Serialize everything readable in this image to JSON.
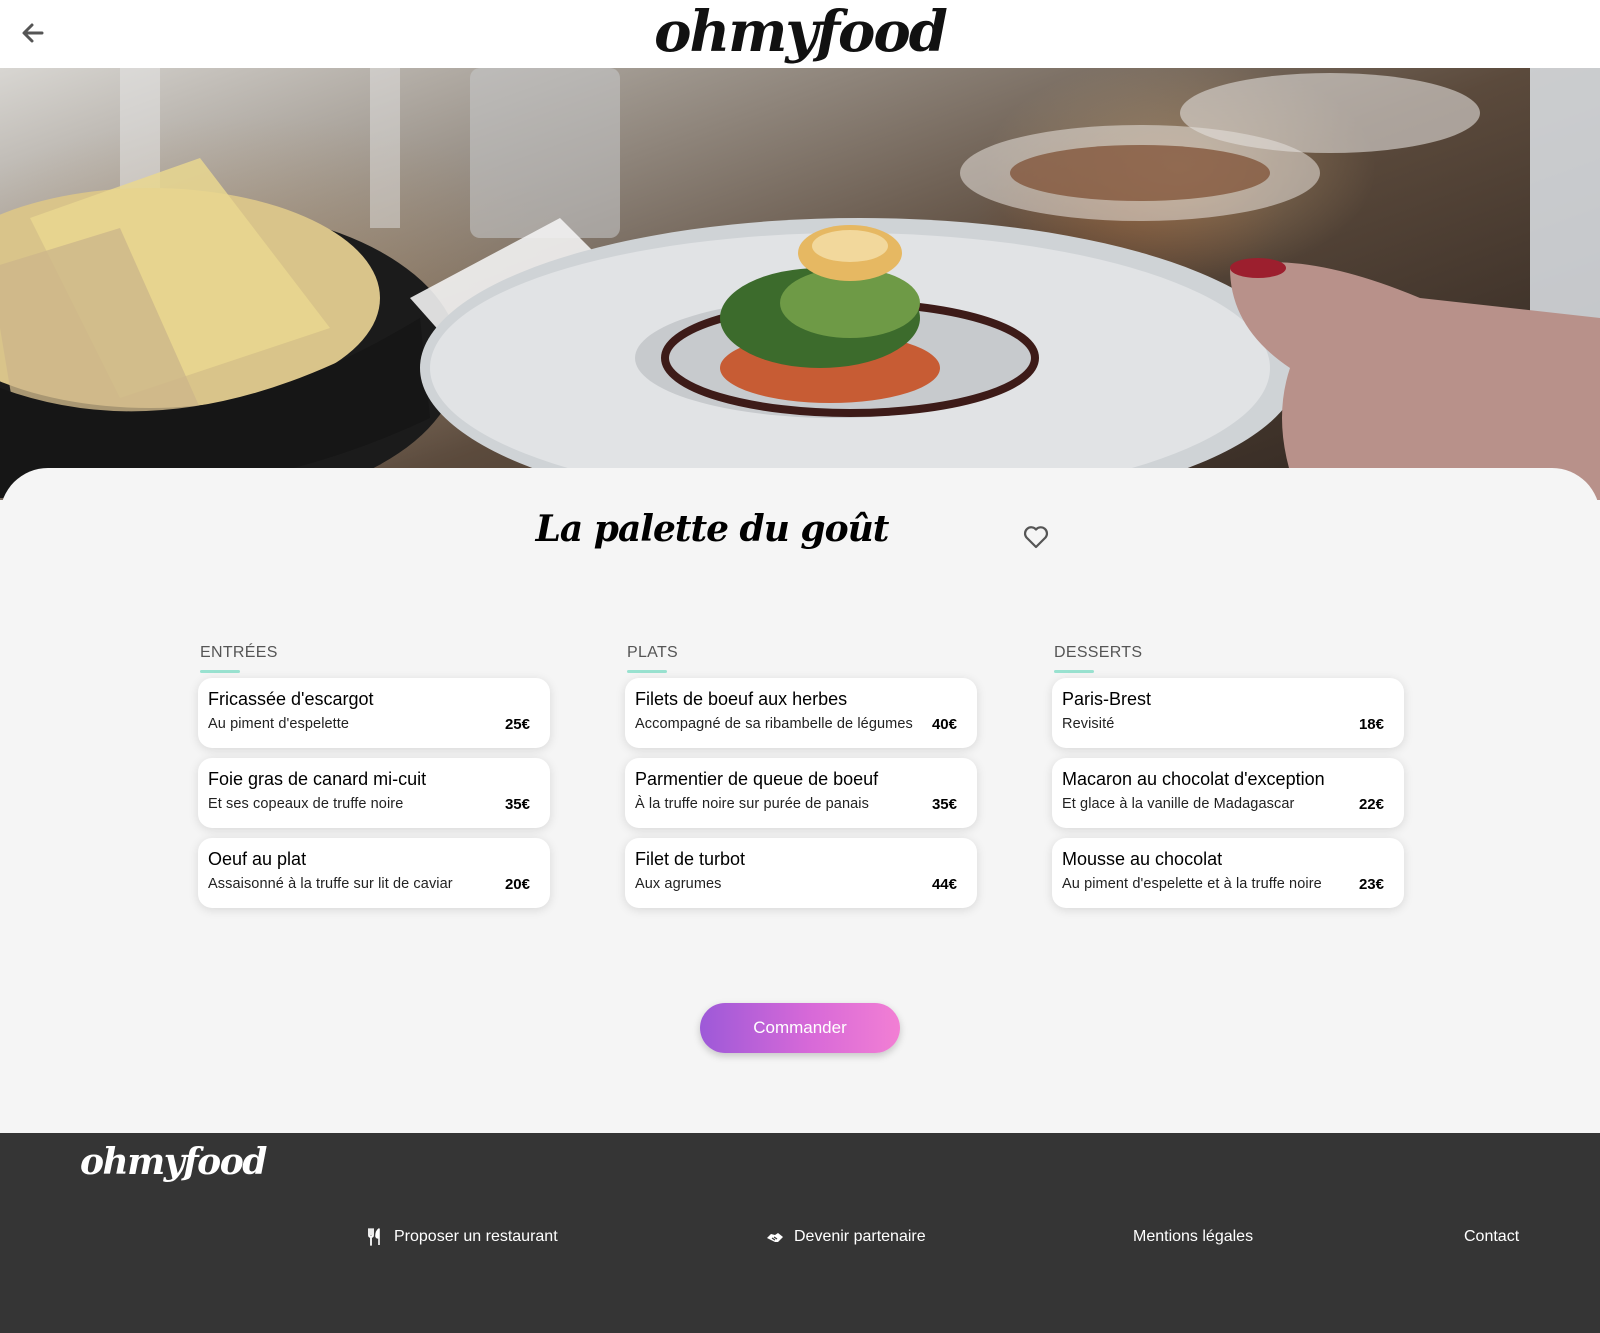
{
  "header": {
    "back_icon": "arrow-left-icon",
    "logo": "ohmyfood"
  },
  "restaurant": {
    "name": "La palette du goût",
    "favorite_icon": "heart-outline-icon"
  },
  "menu": {
    "columns": [
      {
        "title": "ENTRÉES",
        "items": [
          {
            "name": "Fricassée d'escargot",
            "description": "Au piment d'espelette",
            "price": "25€"
          },
          {
            "name": "Foie gras de canard mi-cuit",
            "description": "Et ses copeaux de truffe noire",
            "price": "35€"
          },
          {
            "name": "Oeuf au plat",
            "description": "Assaisonné à la truffe sur lit de caviar",
            "price": "20€"
          }
        ]
      },
      {
        "title": "PLATS",
        "items": [
          {
            "name": "Filets de boeuf aux herbes",
            "description": "Accompagné de sa ribambelle de légumes",
            "price": "40€"
          },
          {
            "name": "Parmentier de queue de boeuf",
            "description": "À la truffe noire sur purée de panais",
            "price": "35€"
          },
          {
            "name": "Filet de turbot",
            "description": "Aux agrumes",
            "price": "44€"
          }
        ]
      },
      {
        "title": "DESSERTS",
        "items": [
          {
            "name": "Paris-Brest",
            "description": "Revisité",
            "price": "18€"
          },
          {
            "name": "Macaron au chocolat d'exception",
            "description": "Et glace à la vanille de Madagascar",
            "price": "22€"
          },
          {
            "name": "Mousse au chocolat",
            "description": "Au piment d'espelette et à la truffe noire",
            "price": "23€"
          }
        ]
      }
    ],
    "underline_color": "#99e2d0"
  },
  "order_button": {
    "label": "Commander",
    "gradient": [
      "#9d59d8",
      "#f27fd4"
    ]
  },
  "footer": {
    "logo": "ohmyfood",
    "links": [
      {
        "label": "Proposer un restaurant",
        "icon": "utensils-icon"
      },
      {
        "label": "Devenir partenaire",
        "icon": "handshake-icon"
      },
      {
        "label": "Mentions légales"
      },
      {
        "label": "Contact"
      }
    ]
  }
}
